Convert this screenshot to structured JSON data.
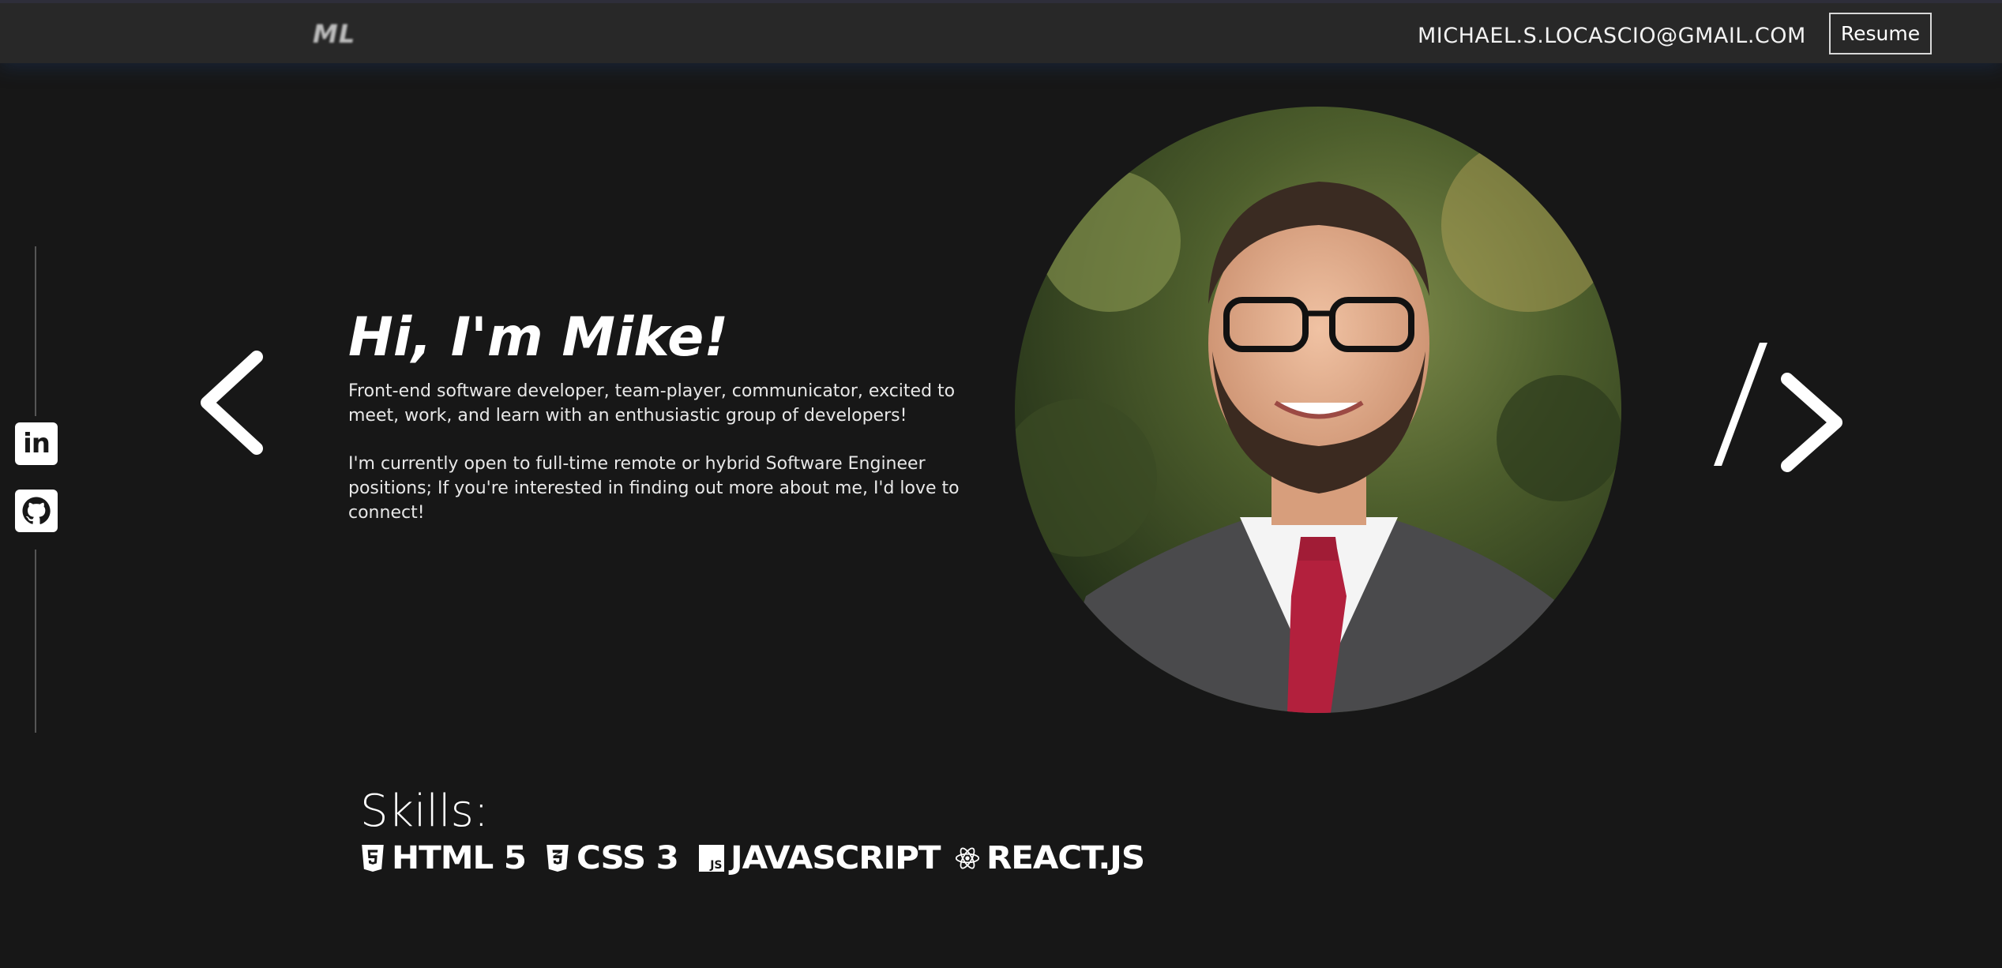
{
  "header": {
    "logo": "ML",
    "email": "MICHAEL.S.LOCASCIO@GMAIL.COM",
    "resume_label": "Resume"
  },
  "social": {
    "icons": [
      "linkedin-icon",
      "github-icon"
    ],
    "linkedin_glyph": "in"
  },
  "hero": {
    "title": "Hi, I'm Mike!",
    "paragraph1": "Front-end software developer, team-player, communicator, excited to meet, work, and learn with an enthusiastic group of developers!",
    "paragraph2": "I'm currently open to full-time remote or hybrid Software Engineer positions; If you're interested in finding out more about me, I'd love to connect!"
  },
  "skills": {
    "title": "Skills:",
    "items": [
      {
        "label": "HTML 5",
        "icon": "html5-icon"
      },
      {
        "label": "CSS 3",
        "icon": "css3-icon"
      },
      {
        "label": "JAVASCRIPT",
        "icon": "javascript-icon"
      },
      {
        "label": "REACT.JS",
        "icon": "react-icon"
      }
    ],
    "js_icon_text": "JS"
  },
  "colors": {
    "background": "#171717",
    "header": "#282828",
    "text": "#ffffff"
  }
}
